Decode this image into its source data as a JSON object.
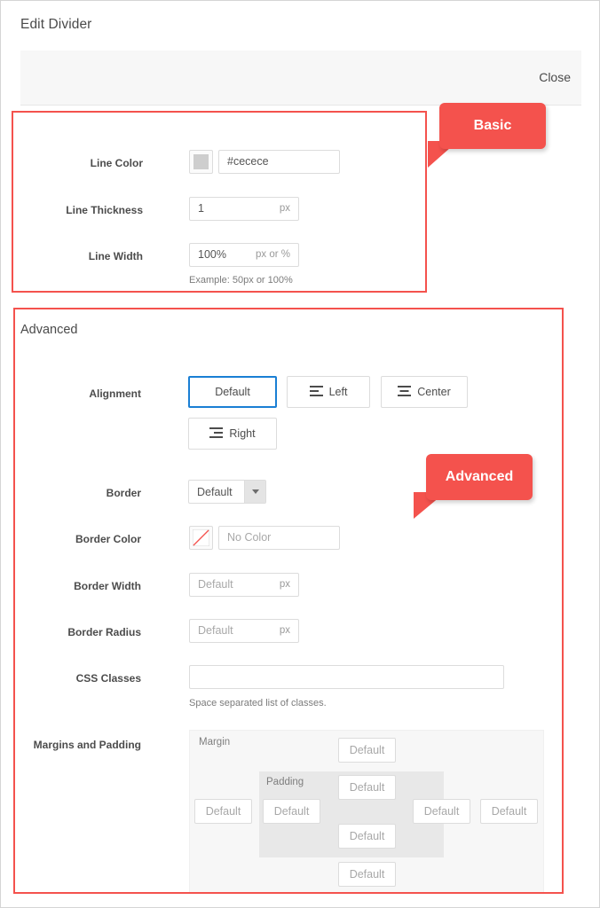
{
  "modal": {
    "title": "Edit Divider",
    "close_label": "Close"
  },
  "annotations": [
    {
      "label": "Basic"
    },
    {
      "label": "Advanced"
    }
  ],
  "callouts": {
    "basic": "Basic",
    "advanced": "Advanced"
  },
  "basic_section": {
    "fields": {
      "line_color": {
        "label": "Line Color",
        "value": "#cecece",
        "swatch_color": "#cecece"
      },
      "line_thickness": {
        "label": "Line Thickness",
        "value": "1",
        "unit": "px"
      },
      "line_width": {
        "label": "Line Width",
        "value": "100%",
        "unit": "px or %",
        "help": "Example: 50px or 100%"
      }
    }
  },
  "advanced_section": {
    "title": "Advanced",
    "alignment": {
      "label": "Alignment",
      "options": [
        {
          "label": "Default",
          "icon": "none",
          "active": true
        },
        {
          "label": "Left",
          "icon": "align-left-icon",
          "active": false
        },
        {
          "label": "Center",
          "icon": "align-center-icon",
          "active": false
        },
        {
          "label": "Right",
          "icon": "align-right-icon",
          "active": false
        }
      ]
    },
    "border": {
      "label": "Border",
      "selected": "Default"
    },
    "border_color": {
      "label": "Border Color",
      "placeholder": "No Color",
      "value": "",
      "swatch": "no-color"
    },
    "border_width": {
      "label": "Border Width",
      "placeholder": "Default",
      "unit": "px"
    },
    "border_radius": {
      "label": "Border Radius",
      "placeholder": "Default",
      "unit": "px"
    },
    "css_classes": {
      "label": "CSS Classes",
      "value": "",
      "help": "Space separated list of classes."
    },
    "margins_and_padding": {
      "label": "Margins and Padding",
      "margin_caption": "Margin",
      "padding_caption": "Padding",
      "margin": {
        "top": "Default",
        "right": "Default",
        "bottom": "Default",
        "left": "Default"
      },
      "padding": {
        "top": "Default",
        "right": "Default",
        "bottom": "Default",
        "left": "Default"
      }
    }
  },
  "colors": {
    "accent_red": "#f4524d",
    "focus_blue": "#1a7fd4",
    "line_color_swatch": "#cecece"
  }
}
